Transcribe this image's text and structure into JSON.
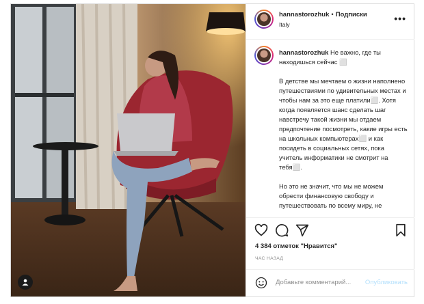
{
  "post": {
    "username": "hannastorozhuk",
    "separator": "•",
    "follow_label": "Подписки",
    "location": "Italy",
    "more_label": "•••"
  },
  "caption": {
    "username": "hannastorozhuk",
    "line1": "Не важно, где ты находишься сейчас ⬜",
    "para1": "В детстве мы мечтаем о жизни наполнено путешествиями по удивительных местах и чтобы нам за это еще платили⬜. Хотя когда появляется шанс сделать шаг навстречу такой жизни мы отдаем предпочтение посмотреть, какие игры есть на школьных компьютерах⬜ и как посидеть в социальных сетях, пока учитель информатики не смотрит на тебя⬜.",
    "para2": "Но это не значит, что мы не можем обрести финансовую свободу и путешествовать по всему миру, не"
  },
  "stats": {
    "likes": "4 384 отметок \"Нравится\"",
    "time": "ЧАС НАЗАД"
  },
  "comment": {
    "placeholder": "Добавьте комментарий...",
    "post_label": "Опубликовать"
  },
  "icons": {
    "like": "heart-icon",
    "comment": "comment-icon",
    "share": "share-icon",
    "save": "bookmark-icon",
    "emoji": "smile-icon",
    "tag": "person-tag-icon"
  },
  "colors": {
    "post_button_disabled": "#b2dffc",
    "border": "#dbdbdb",
    "muted_text": "#8e8e8e"
  }
}
